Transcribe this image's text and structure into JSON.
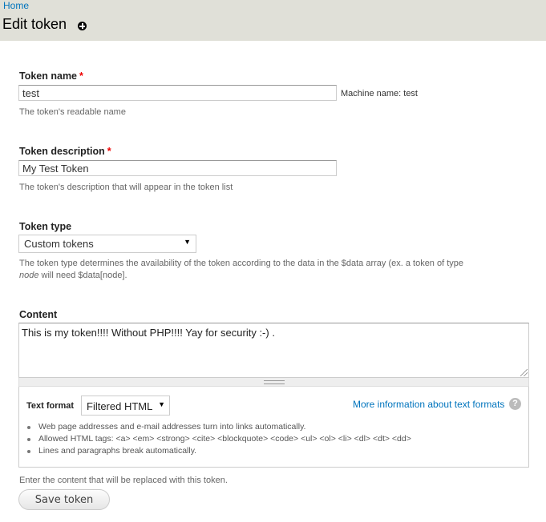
{
  "header": {
    "breadcrumb": "Home",
    "title": "Edit token",
    "shortcut_icon": "add-shortcut-icon"
  },
  "form": {
    "token_name": {
      "label": "Token name",
      "required_mark": "*",
      "value": "test",
      "machine_name": "Machine name: test",
      "description": "The token's readable name"
    },
    "token_description": {
      "label": "Token description",
      "required_mark": "*",
      "value": "My Test Token",
      "description": "The token's description that will appear in the token list"
    },
    "token_type": {
      "label": "Token type",
      "selected": "Custom tokens",
      "arrow": "▼",
      "description_part1": "The token type determines the availability of the token according to the data in the $data array (ex. a token of type ",
      "description_em": "node",
      "description_part2": " will need $data[node]."
    },
    "content": {
      "label": "Content",
      "value": "This is my token!!!! Without PHP!!!! Yay for security :-) .",
      "description": "Enter the content that will be replaced with this token."
    },
    "text_format": {
      "label": "Text format",
      "selected": "Filtered HTML",
      "arrow": "▼",
      "more_info_link": "More information about text formats",
      "help_icon": "?",
      "tips": [
        "Web page addresses and e-mail addresses turn into links automatically.",
        "Allowed HTML tags: <a> <em> <strong> <cite> <blockquote> <code> <ul> <ol> <li> <dl> <dt> <dd>",
        "Lines and paragraphs break automatically."
      ]
    },
    "save_label": "Save token"
  },
  "colors": {
    "link": "#0074bd",
    "header_bg": "#e0e0d8",
    "required": "#ee0000"
  }
}
